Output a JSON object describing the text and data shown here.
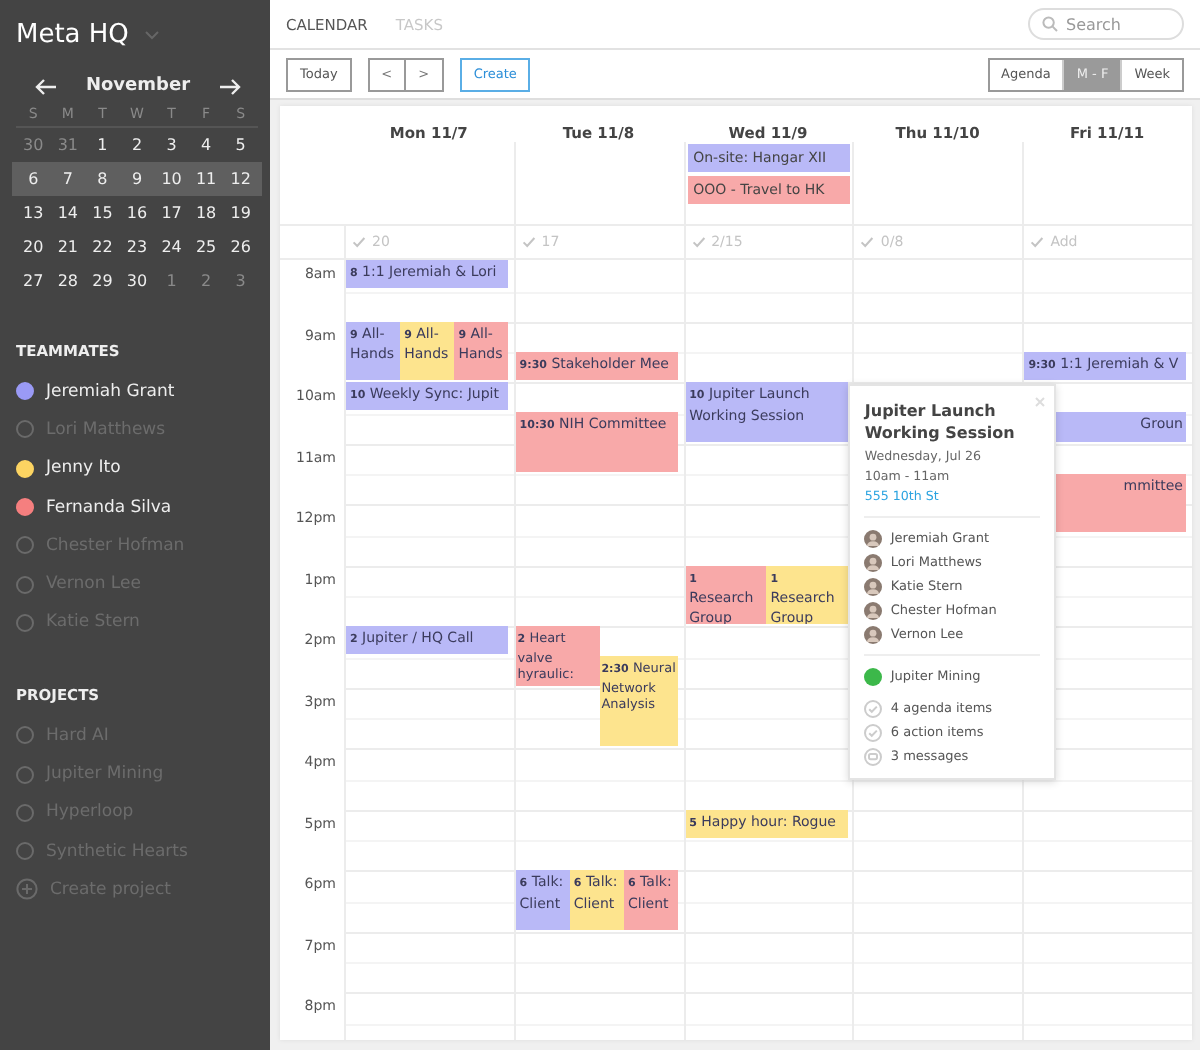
{
  "workspace": {
    "title": "Meta HQ"
  },
  "mini_calendar": {
    "month": "November",
    "weekdays": [
      "S",
      "M",
      "T",
      "W",
      "T",
      "F",
      "S"
    ],
    "weeks": [
      {
        "selected": false,
        "days": [
          {
            "label": "30",
            "in_month": false
          },
          {
            "label": "31",
            "in_month": false
          },
          {
            "label": "1",
            "in_month": true
          },
          {
            "label": "2",
            "in_month": true
          },
          {
            "label": "3",
            "in_month": true
          },
          {
            "label": "4",
            "in_month": true
          },
          {
            "label": "5",
            "in_month": true
          }
        ]
      },
      {
        "selected": true,
        "days": [
          {
            "label": "6",
            "in_month": true
          },
          {
            "label": "7",
            "in_month": true
          },
          {
            "label": "8",
            "in_month": true
          },
          {
            "label": "9",
            "in_month": true
          },
          {
            "label": "10",
            "in_month": true
          },
          {
            "label": "11",
            "in_month": true
          },
          {
            "label": "12",
            "in_month": true
          }
        ]
      },
      {
        "selected": false,
        "days": [
          {
            "label": "13",
            "in_month": true
          },
          {
            "label": "14",
            "in_month": true
          },
          {
            "label": "15",
            "in_month": true
          },
          {
            "label": "16",
            "in_month": true
          },
          {
            "label": "17",
            "in_month": true
          },
          {
            "label": "18",
            "in_month": true
          },
          {
            "label": "19",
            "in_month": true
          }
        ]
      },
      {
        "selected": false,
        "days": [
          {
            "label": "20",
            "in_month": true
          },
          {
            "label": "21",
            "in_month": true
          },
          {
            "label": "22",
            "in_month": true
          },
          {
            "label": "23",
            "in_month": true
          },
          {
            "label": "24",
            "in_month": true
          },
          {
            "label": "25",
            "in_month": true
          },
          {
            "label": "26",
            "in_month": true
          }
        ]
      },
      {
        "selected": false,
        "days": [
          {
            "label": "27",
            "in_month": true
          },
          {
            "label": "28",
            "in_month": true
          },
          {
            "label": "29",
            "in_month": true
          },
          {
            "label": "30",
            "in_month": true
          },
          {
            "label": "1",
            "in_month": false
          },
          {
            "label": "2",
            "in_month": false
          },
          {
            "label": "3",
            "in_month": false
          }
        ]
      }
    ]
  },
  "teammates": {
    "heading": "TEAMMATES",
    "items": [
      {
        "name": "Jeremiah Grant",
        "selected": true,
        "color": "#9a9af5"
      },
      {
        "name": "Lori Matthews",
        "selected": false
      },
      {
        "name": "Jenny Ito",
        "selected": true,
        "color": "#fcd462"
      },
      {
        "name": "Fernanda Silva",
        "selected": true,
        "color": "#f57f7f"
      },
      {
        "name": "Chester Hofman",
        "selected": false
      },
      {
        "name": "Vernon Lee",
        "selected": false
      },
      {
        "name": "Katie Stern",
        "selected": false
      }
    ]
  },
  "projects": {
    "heading": "PROJECTS",
    "items": [
      {
        "name": "Hard AI",
        "selected": false
      },
      {
        "name": "Jupiter Mining",
        "selected": false
      },
      {
        "name": "Hyperloop",
        "selected": false
      },
      {
        "name": "Synthetic Hearts",
        "selected": false
      }
    ],
    "create": "Create project"
  },
  "tabs": [
    {
      "label": "CALENDAR",
      "selected": true
    },
    {
      "label": "TASKS",
      "selected": false
    }
  ],
  "search": {
    "placeholder": "Search"
  },
  "toolbar": {
    "today": "Today",
    "prev": "<",
    "next": ">",
    "create": "Create"
  },
  "views": [
    {
      "label": "Agenda",
      "selected": false
    },
    {
      "label": "M - F",
      "selected": true
    },
    {
      "label": "Week",
      "selected": false
    }
  ],
  "hours": [
    "8am",
    "9am",
    "10am",
    "11am",
    "12pm",
    "1pm",
    "2pm",
    "3pm",
    "4pm",
    "5pm",
    "6pm",
    "7pm",
    "8pm"
  ],
  "days": [
    {
      "label": "Mon 11/7",
      "tasks": "20",
      "slots": [
        {
          "kind": "split",
          "events": [
            {
              "time": "8",
              "title": "1:1 Jeremiah & Lori",
              "kind": "half",
              "color": "#b9b9f7"
            }
          ]
        },
        {
          "kind": "split",
          "events": [
            {
              "time": "9",
              "title": "All-Hands",
              "kind": "hour",
              "color": "#b9b9f7"
            },
            {
              "time": "9",
              "title": "All-Hands",
              "kind": "hour",
              "color": "#fde48e"
            },
            {
              "time": "9",
              "title": "All-Hands",
              "kind": "hour",
              "color": "#f8a9a9"
            }
          ]
        },
        {
          "kind": "split",
          "events": [
            {
              "time": "10",
              "title": "Weekly Sync: Jupit",
              "kind": "half",
              "color": "#b9b9f7"
            }
          ]
        },
        {
          "kind": "split",
          "events": [
            {
              "time": "2",
              "title": "Jupiter / HQ Call",
              "kind": "half",
              "color": "#b9b9f7"
            }
          ]
        }
      ]
    },
    {
      "label": "Tue 11/8",
      "tasks": "17",
      "slots": [
        {
          "kind": "split",
          "events": [
            {
              "time": "9:30",
              "title": "Stakeholder Mee",
              "kind": "half",
              "color": "#f8a9a9"
            }
          ]
        },
        {
          "kind": "split",
          "events": [
            {
              "time": "10:30",
              "title": "NIH Committee",
              "kind": "hour",
              "color": "#f8a9a9"
            }
          ]
        },
        {
          "kind": "cascade",
          "events": [
            {
              "time": "2",
              "title": "Heart valve hyraulic:",
              "kind": "hour",
              "color": "#f8a9a9"
            },
            {
              "time": "2:30",
              "title": "Neural Network Analysis",
              "kind": "long",
              "color": "#fde48e"
            }
          ]
        },
        {
          "kind": "split",
          "events": [
            {
              "time": "6",
              "title": "Talk: Client",
              "kind": "hour",
              "color": "#b9b9f7"
            },
            {
              "time": "6",
              "title": "Talk: Client",
              "kind": "hour",
              "color": "#fde48e"
            },
            {
              "time": "6",
              "title": "Talk: Client",
              "kind": "hour",
              "color": "#f8a9a9"
            }
          ]
        }
      ]
    },
    {
      "label": "Wed 11/9",
      "tasks": "2/15",
      "all_day": [
        {
          "title": "On-site: Hangar XII",
          "color": "#b9b9f7"
        },
        {
          "title": "OOO - Travel to HK",
          "color": "#f8a9a9"
        }
      ],
      "slots": [
        {
          "kind": "split",
          "events": [
            {
              "time": "10",
              "title": "Jupiter Launch Working Session",
              "kind": "hour",
              "color": "#b9b9f7"
            }
          ]
        },
        {
          "kind": "split",
          "events": [
            {
              "time": "1",
              "title": "Research Group",
              "kind": "hour",
              "color": "#f8a9a9"
            },
            {
              "time": "1",
              "title": "Research Group",
              "kind": "hour",
              "color": "#fde48e"
            }
          ]
        },
        {
          "kind": "split",
          "events": [
            {
              "time": "5",
              "title": "Happy hour: Rogue",
              "kind": "half",
              "color": "#fde48e"
            }
          ]
        }
      ]
    },
    {
      "label": "Thu 11/10",
      "tasks": "0/8"
    },
    {
      "label": "Fri 11/11",
      "tasks": "Add",
      "slots": [
        {
          "kind": "split",
          "events": [
            {
              "time": "9:30",
              "title": "1:1 Jeremiah & V",
              "kind": "half",
              "color": "#b9b9f7"
            }
          ]
        },
        {
          "kind": "split",
          "events": [
            {
              "title": "Groun",
              "kind": "half",
              "color": "#b9b9f7",
              "covered": true
            }
          ]
        },
        {
          "kind": "split",
          "events": [
            {
              "title": "mmittee",
              "kind": "hour",
              "color": "#f8a9a9",
              "covered": true
            }
          ]
        }
      ]
    }
  ],
  "popup": {
    "title": "Jupiter Launch Working Session",
    "date": "Wednesday, Jul 26",
    "time": "10am - 11am",
    "location": "555 10th St",
    "attendees": [
      "Jeremiah Grant",
      "Lori Matthews",
      "Katie Stern",
      "Chester Hofman",
      "Vernon Lee"
    ],
    "project": {
      "name": "Jupiter Mining",
      "color": "#3cb84a"
    },
    "items": [
      {
        "kind": "check",
        "text": "4 agenda items"
      },
      {
        "kind": "check",
        "text": "6 action items"
      },
      {
        "kind": "message",
        "text": "3 messages"
      }
    ]
  }
}
